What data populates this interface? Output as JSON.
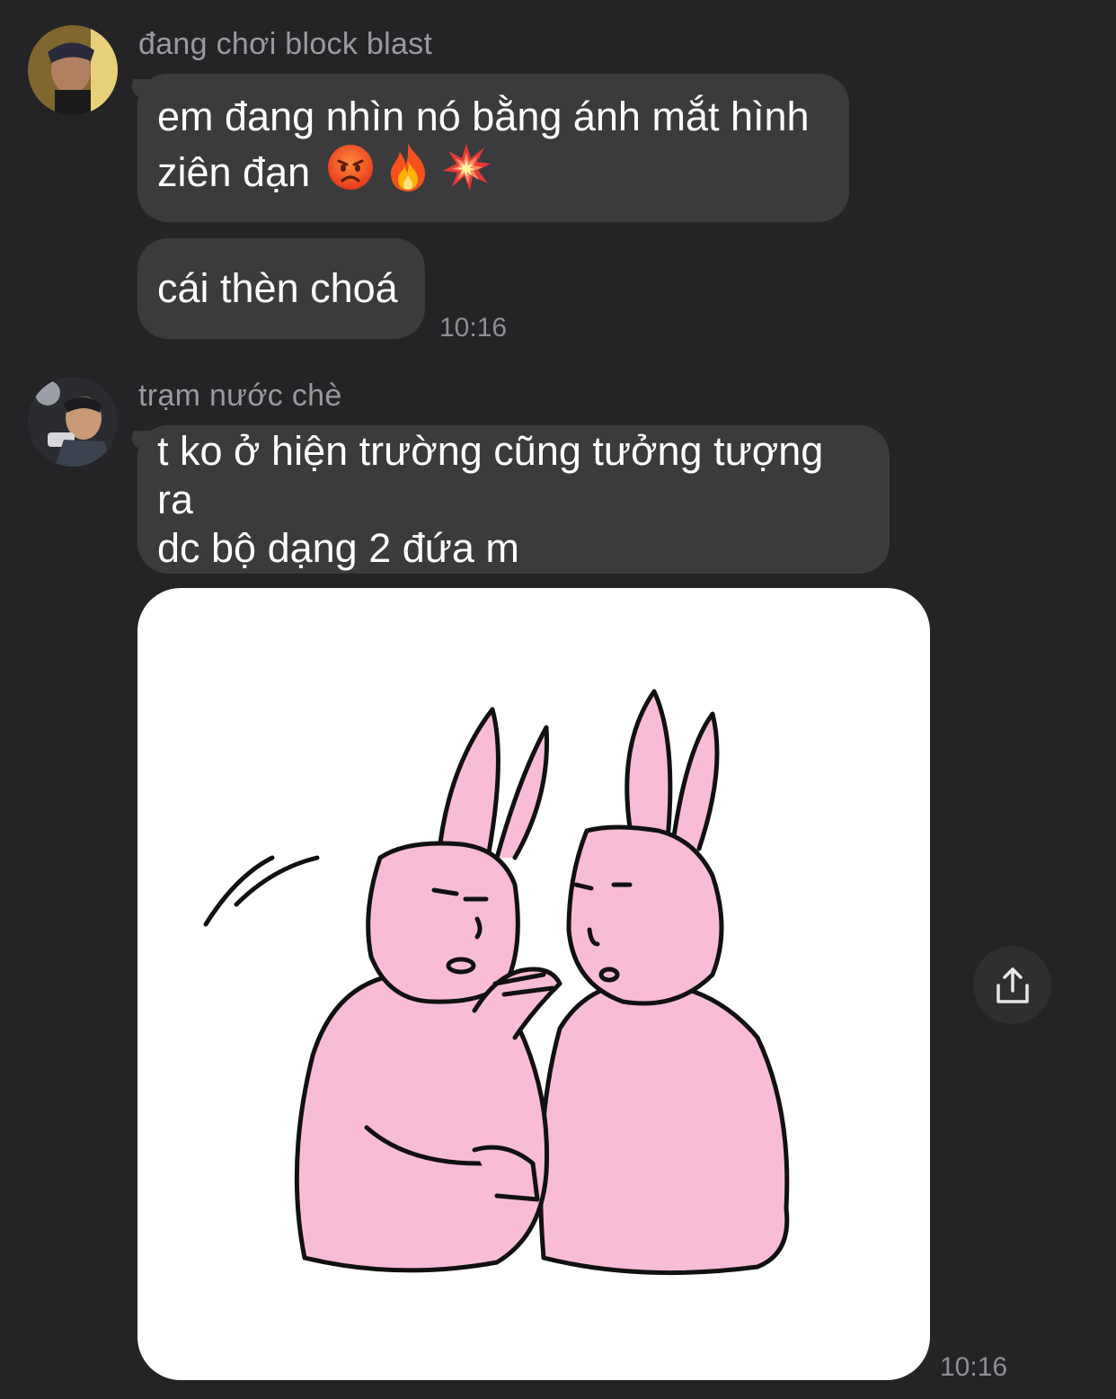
{
  "messages": [
    {
      "sender": "đang chơi block blast",
      "bubbles": [
        {
          "line1": "em đang nhìn nó bằng ánh mắt hình",
          "line2": "ziên đạn",
          "emojis": [
            "angry-face",
            "fire",
            "collision"
          ]
        },
        {
          "text": "cái thèn choá"
        }
      ],
      "time": "10:16"
    },
    {
      "sender": "trạm nước chè",
      "bubbles": [
        {
          "line1": "t ko ở hiện trường cũng tưởng tượng ra",
          "line2": "dc bộ dạng 2 đứa m"
        }
      ],
      "sticker": {
        "description_icon": "two-pink-rabbits-sticker"
      },
      "time": "10:16"
    }
  ],
  "colors": {
    "background": "#242426",
    "bubble": "#3b3b3e",
    "sender": "#9a9a9e",
    "rabbit": "#f9bcd7"
  }
}
